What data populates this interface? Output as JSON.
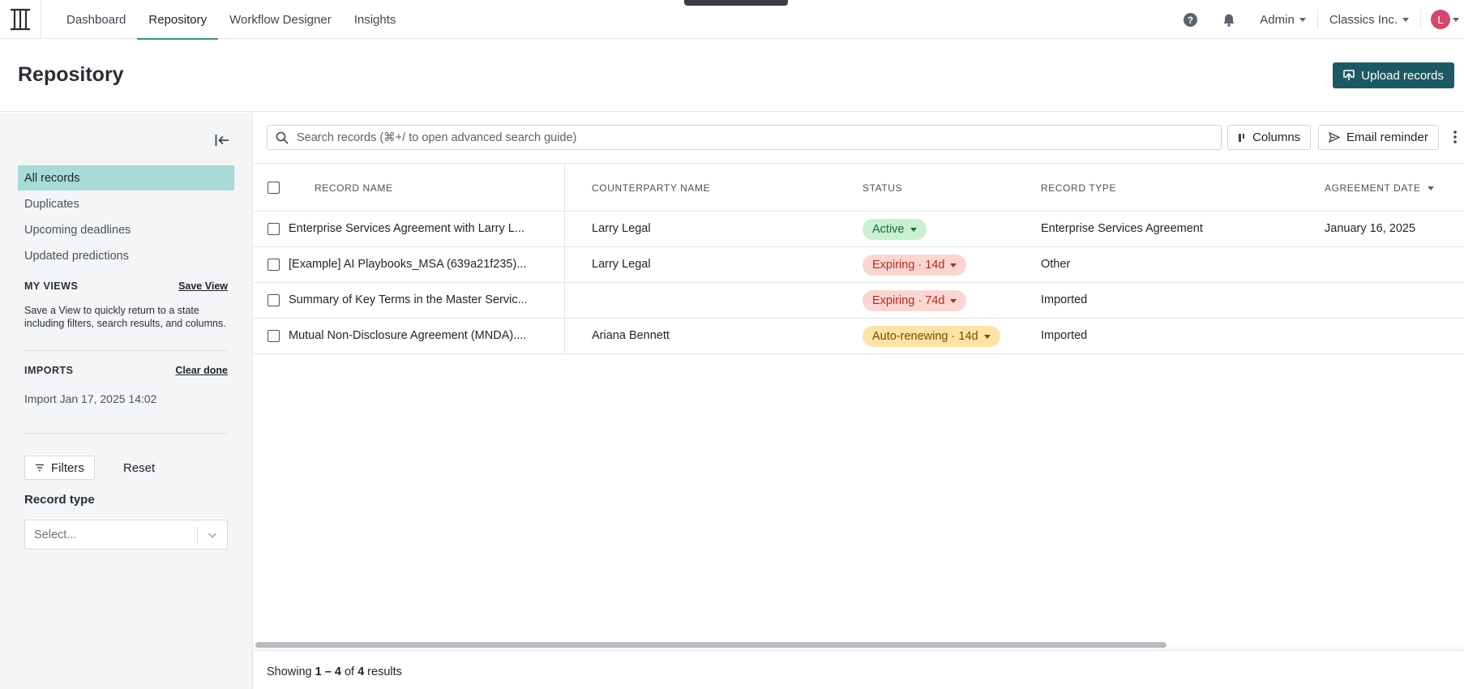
{
  "topnav": {
    "tabs": [
      {
        "label": "Dashboard"
      },
      {
        "label": "Repository",
        "active": true
      },
      {
        "label": "Workflow Designer"
      },
      {
        "label": "Insights"
      }
    ],
    "admin_label": "Admin",
    "org_label": "Classics Inc.",
    "avatar_initial": "L"
  },
  "page": {
    "title": "Repository",
    "upload_label": "Upload records"
  },
  "sidebar": {
    "nav": [
      {
        "label": "All records",
        "active": true
      },
      {
        "label": "Duplicates"
      },
      {
        "label": "Upcoming deadlines"
      },
      {
        "label": "Updated predictions"
      }
    ],
    "views": {
      "heading": "MY VIEWS",
      "action": "Save View",
      "description": "Save a View to quickly return to a state including filters, search results, and columns."
    },
    "imports": {
      "heading": "IMPORTS",
      "action": "Clear done",
      "item": "Import Jan 17, 2025 14:02"
    },
    "filters_label": "Filters",
    "reset_label": "Reset",
    "record_type_label": "Record type",
    "record_type_placeholder": "Select..."
  },
  "toolbar": {
    "search_placeholder": "Search records (⌘+/ to open advanced search guide)",
    "columns_label": "Columns",
    "email_label": "Email reminder"
  },
  "table": {
    "headers": {
      "name": "RECORD NAME",
      "counterparty": "COUNTERPARTY NAME",
      "status": "STATUS",
      "type": "RECORD TYPE",
      "date": "AGREEMENT DATE"
    },
    "rows": [
      {
        "name": "Enterprise Services Agreement with Larry L...",
        "counterparty": "Larry Legal",
        "status": "Active",
        "status_color": "green",
        "type": "Enterprise Services Agreement",
        "date": "January 16, 2025"
      },
      {
        "name": "[Example] AI Playbooks_MSA (639a21f235)...",
        "counterparty": "Larry Legal",
        "status": "Expiring · 14d",
        "status_color": "red",
        "type": "Other",
        "date": ""
      },
      {
        "name": "Summary of Key Terms in the Master Servic...",
        "counterparty": "",
        "status": "Expiring · 74d",
        "status_color": "red",
        "type": "Imported",
        "date": ""
      },
      {
        "name": "Mutual Non-Disclosure Agreement (MNDA)....",
        "counterparty": "Ariana Bennett",
        "status": "Auto-renewing · 14d",
        "status_color": "amber",
        "type": "Imported",
        "date": ""
      }
    ]
  },
  "footer": {
    "prefix": "Showing",
    "range": "1 – 4",
    "of": "of",
    "total": "4",
    "suffix": "results"
  }
}
